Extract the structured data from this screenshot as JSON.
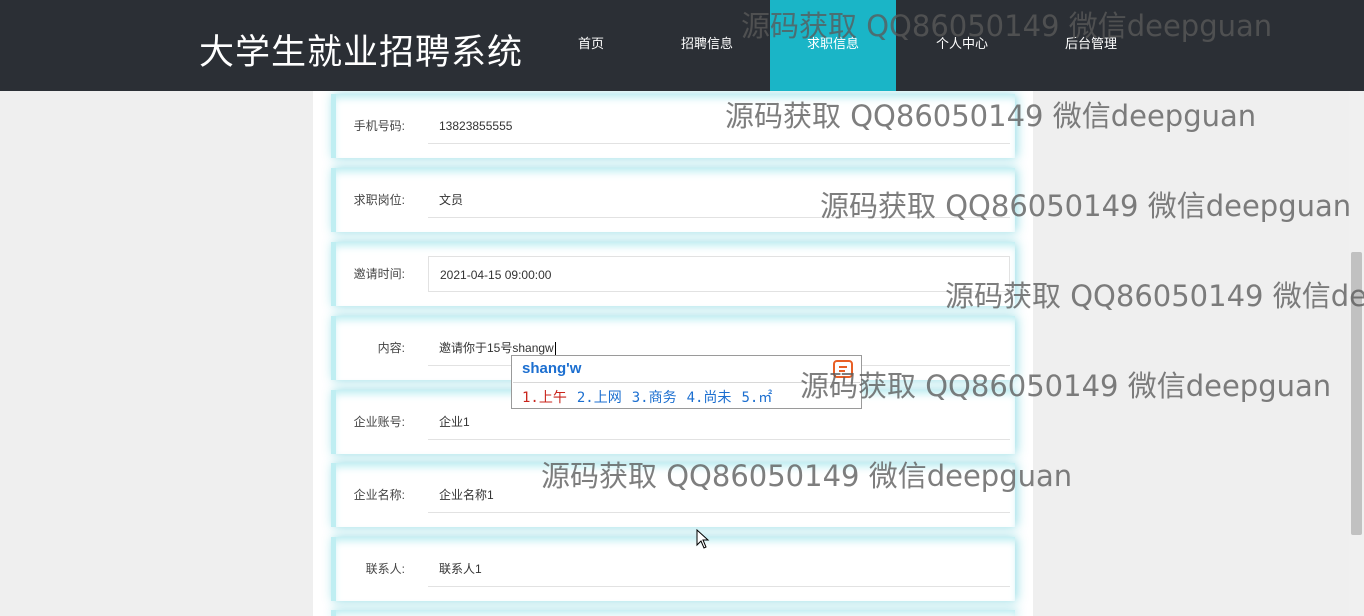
{
  "header": {
    "site_title": "大学生就业招聘系统",
    "nav": [
      {
        "label": "首页",
        "active": false
      },
      {
        "label": "招聘信息",
        "active": false
      },
      {
        "label": "求职信息",
        "active": true
      },
      {
        "label": "个人中心",
        "active": false
      },
      {
        "label": "后台管理",
        "active": false
      }
    ]
  },
  "form": {
    "rows": [
      {
        "label": "手机号码:",
        "value": "13823855555"
      },
      {
        "label": "求职岗位:",
        "value": "文员"
      },
      {
        "label": "邀请时间:",
        "value": "2021-04-15 09:00:00"
      },
      {
        "label": "内容:",
        "value": "邀请你于15号shangw"
      },
      {
        "label": "企业账号:",
        "value": "企业1"
      },
      {
        "label": "企业名称:",
        "value": "企业名称1"
      },
      {
        "label": "联系人:",
        "value": "联系人1"
      }
    ]
  },
  "ime": {
    "composition": "shang'w",
    "candidates": [
      "1.上午",
      "2.上网",
      "3.商务",
      "4.尚未",
      "5.㎡"
    ]
  },
  "watermark": "源码获取 QQ86050149 微信deepguan",
  "colors": {
    "header_bg": "#2b2f35",
    "nav_active": "#1ab5c7",
    "row_glow": "#bfeef2"
  }
}
